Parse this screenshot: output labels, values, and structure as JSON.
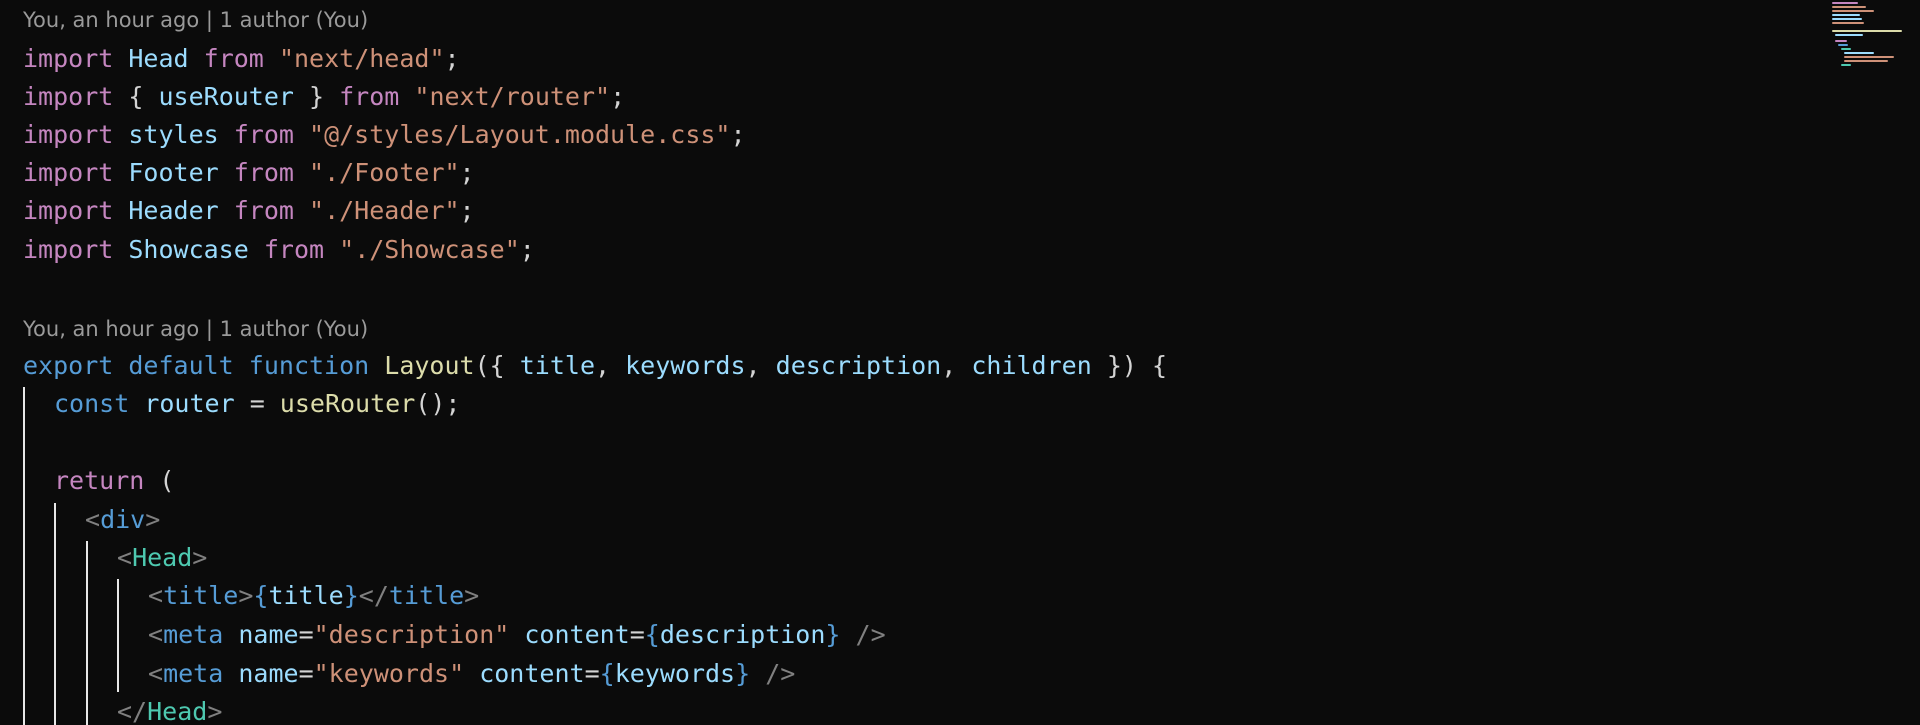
{
  "blame": {
    "first": "You, an hour ago | 1 author (You)",
    "second": "You, an hour ago | 1 author (You)"
  },
  "code": {
    "l1": {
      "t1": "import",
      "t2": "Head",
      "t3": "from",
      "t4": "\"next/head\"",
      "t5": ";"
    },
    "l2": {
      "t1": "import",
      "t2": "{ ",
      "t3": "useRouter",
      "t4": " }",
      "t5": "from",
      "t6": "\"next/router\"",
      "t7": ";"
    },
    "l3": {
      "t1": "import",
      "t2": "styles",
      "t3": "from",
      "t4": "\"@/styles/Layout.module.css\"",
      "t5": ";"
    },
    "l4": {
      "t1": "import",
      "t2": "Footer",
      "t3": "from",
      "t4": "\"./Footer\"",
      "t5": ";"
    },
    "l5": {
      "t1": "import",
      "t2": "Header",
      "t3": "from",
      "t4": "\"./Header\"",
      "t5": ";"
    },
    "l6": {
      "t1": "import",
      "t2": "Showcase",
      "t3": "from",
      "t4": "\"./Showcase\"",
      "t5": ";"
    },
    "l7": {
      "t1": "export",
      "t2": "default",
      "t3": "function",
      "t4": "Layout",
      "t5": "({ ",
      "t6": "title",
      "t7": ", ",
      "t8": "keywords",
      "t9": ", ",
      "t10": "description",
      "t11": ", ",
      "t12": "children",
      "t13": " }) {"
    },
    "l8": {
      "t1": "const",
      "t2": "router",
      "t3": " = ",
      "t4": "useRouter",
      "t5": "();"
    },
    "l9": {
      "t1": "return",
      "t2": " ("
    },
    "l10": {
      "t1": "<",
      "t2": "div",
      "t3": ">"
    },
    "l11": {
      "t1": "<",
      "t2": "Head",
      "t3": ">"
    },
    "l12": {
      "t1": "<",
      "t2": "title",
      "t3": ">",
      "t4": "{",
      "t5": "title",
      "t6": "}",
      "t7": "</",
      "t8": "title",
      "t9": ">"
    },
    "l13": {
      "t1": "<",
      "t2": "meta",
      "t3": "name",
      "t4": "=",
      "t5": "\"description\"",
      "t6": "content",
      "t7": "=",
      "t8": "{",
      "t9": "description",
      "t10": "}",
      "t11": " />"
    },
    "l14": {
      "t1": "<",
      "t2": "meta",
      "t3": "name",
      "t4": "=",
      "t5": "\"keywords\"",
      "t6": "content",
      "t7": "=",
      "t8": "{",
      "t9": "keywords",
      "t10": "}",
      "t11": " />"
    },
    "l15": {
      "t1": "</",
      "t2": "Head",
      "t3": ">"
    }
  },
  "colors": {
    "background": "#0b0b0b",
    "keyword": "#c586c0",
    "storage": "#569cd6",
    "variable": "#9cdcfe",
    "function": "#dcdcaa",
    "string": "#ce9178",
    "component": "#4ec9b0",
    "tag_punctuation": "#808080",
    "codelens": "#9a9a9a"
  }
}
